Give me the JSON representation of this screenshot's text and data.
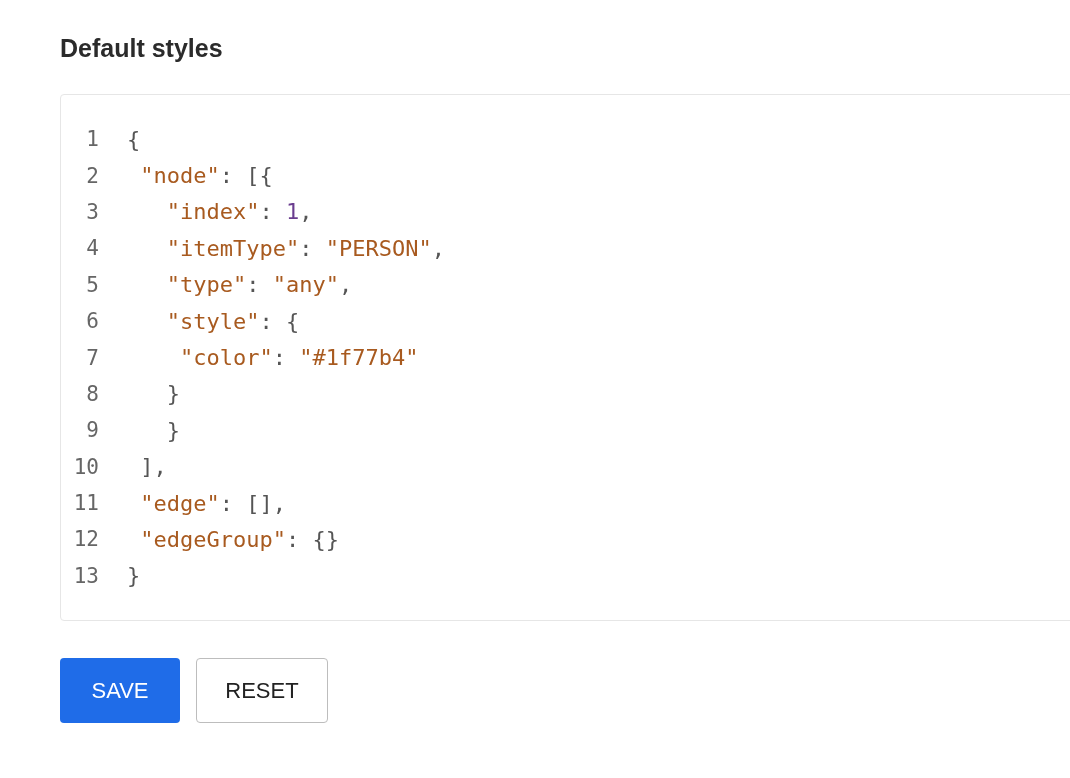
{
  "title": "Default styles",
  "editor": {
    "lines": [
      {
        "number": "1",
        "tokens": [
          {
            "kind": "punct",
            "text": "{"
          }
        ]
      },
      {
        "number": "2",
        "tokens": [
          {
            "kind": "key",
            "text": " \"node\""
          },
          {
            "kind": "punct",
            "text": ": [{"
          }
        ]
      },
      {
        "number": "3",
        "tokens": [
          {
            "kind": "key",
            "text": "   \"index\""
          },
          {
            "kind": "punct",
            "text": ": "
          },
          {
            "kind": "number",
            "text": "1"
          },
          {
            "kind": "punct",
            "text": ","
          }
        ]
      },
      {
        "number": "4",
        "tokens": [
          {
            "kind": "key",
            "text": "   \"itemType\""
          },
          {
            "kind": "punct",
            "text": ": "
          },
          {
            "kind": "string",
            "text": "\"PERSON\""
          },
          {
            "kind": "punct",
            "text": ","
          }
        ]
      },
      {
        "number": "5",
        "tokens": [
          {
            "kind": "key",
            "text": "   \"type\""
          },
          {
            "kind": "punct",
            "text": ": "
          },
          {
            "kind": "string",
            "text": "\"any\""
          },
          {
            "kind": "punct",
            "text": ","
          }
        ]
      },
      {
        "number": "6",
        "tokens": [
          {
            "kind": "key",
            "text": "   \"style\""
          },
          {
            "kind": "punct",
            "text": ": {"
          }
        ]
      },
      {
        "number": "7",
        "tokens": [
          {
            "kind": "key",
            "text": "    \"color\""
          },
          {
            "kind": "punct",
            "text": ": "
          },
          {
            "kind": "string",
            "text": "\"#1f77b4\""
          }
        ]
      },
      {
        "number": "8",
        "tokens": [
          {
            "kind": "punct",
            "text": "   }"
          }
        ]
      },
      {
        "number": "9",
        "tokens": [
          {
            "kind": "punct",
            "text": "   }"
          }
        ]
      },
      {
        "number": "10",
        "tokens": [
          {
            "kind": "punct",
            "text": " ],"
          }
        ]
      },
      {
        "number": "11",
        "tokens": [
          {
            "kind": "key",
            "text": " \"edge\""
          },
          {
            "kind": "punct",
            "text": ": [],"
          }
        ]
      },
      {
        "number": "12",
        "tokens": [
          {
            "kind": "key",
            "text": " \"edgeGroup\""
          },
          {
            "kind": "punct",
            "text": ": {}"
          }
        ]
      },
      {
        "number": "13",
        "tokens": [
          {
            "kind": "punct",
            "text": "}"
          }
        ]
      }
    ]
  },
  "buttons": [
    {
      "label": "SAVE",
      "kind": "primary"
    },
    {
      "label": "RESET",
      "kind": "secondary"
    }
  ]
}
